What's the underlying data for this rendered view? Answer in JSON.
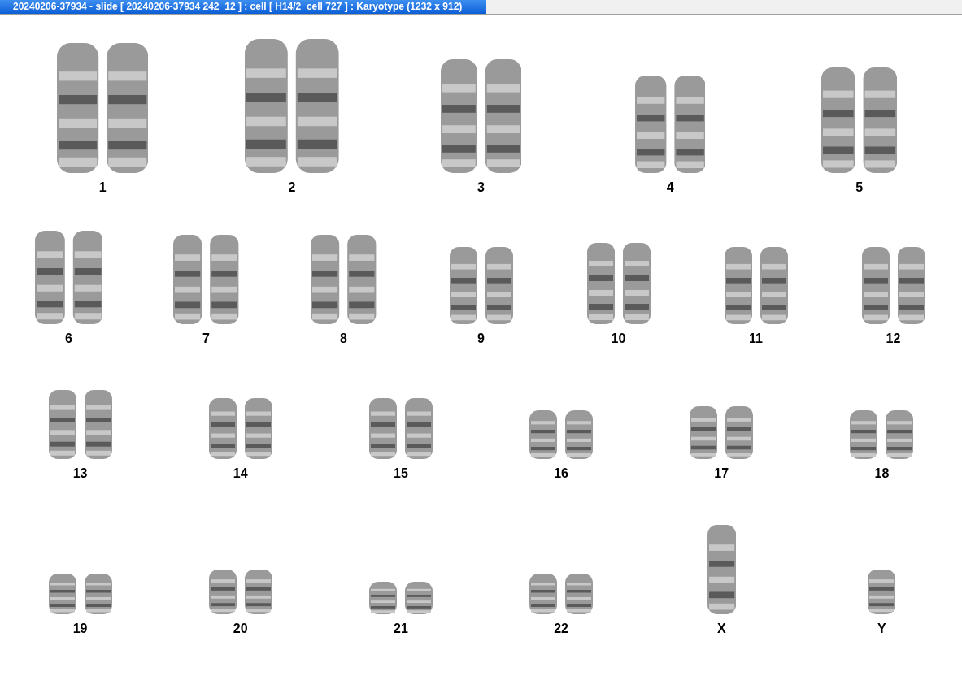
{
  "window": {
    "title": "20240206-37934 - slide [ 20240206-37934 242_12 ] : cell [ H14/2_cell 727 ] : Karyotype  (1232 x 912)"
  },
  "rows": [
    [
      {
        "label": "1",
        "kind": "pair"
      },
      {
        "label": "2",
        "kind": "pair"
      },
      {
        "label": "3",
        "kind": "pair"
      },
      {
        "label": "4",
        "kind": "pair"
      },
      {
        "label": "5",
        "kind": "pair"
      }
    ],
    [
      {
        "label": "6",
        "kind": "pair"
      },
      {
        "label": "7",
        "kind": "pair"
      },
      {
        "label": "8",
        "kind": "pair"
      },
      {
        "label": "9",
        "kind": "pair"
      },
      {
        "label": "10",
        "kind": "pair"
      },
      {
        "label": "11",
        "kind": "pair"
      },
      {
        "label": "12",
        "kind": "pair"
      }
    ],
    [
      {
        "label": "13",
        "kind": "pair"
      },
      {
        "label": "14",
        "kind": "pair"
      },
      {
        "label": "15",
        "kind": "pair"
      },
      {
        "label": "16",
        "kind": "pair"
      },
      {
        "label": "17",
        "kind": "pair"
      },
      {
        "label": "18",
        "kind": "pair"
      }
    ],
    [
      {
        "label": "19",
        "kind": "pair"
      },
      {
        "label": "20",
        "kind": "pair"
      },
      {
        "label": "21",
        "kind": "pair"
      },
      {
        "label": "22",
        "kind": "pair"
      },
      {
        "label": "X",
        "kind": "single"
      },
      {
        "label": "Y",
        "kind": "single"
      }
    ]
  ]
}
